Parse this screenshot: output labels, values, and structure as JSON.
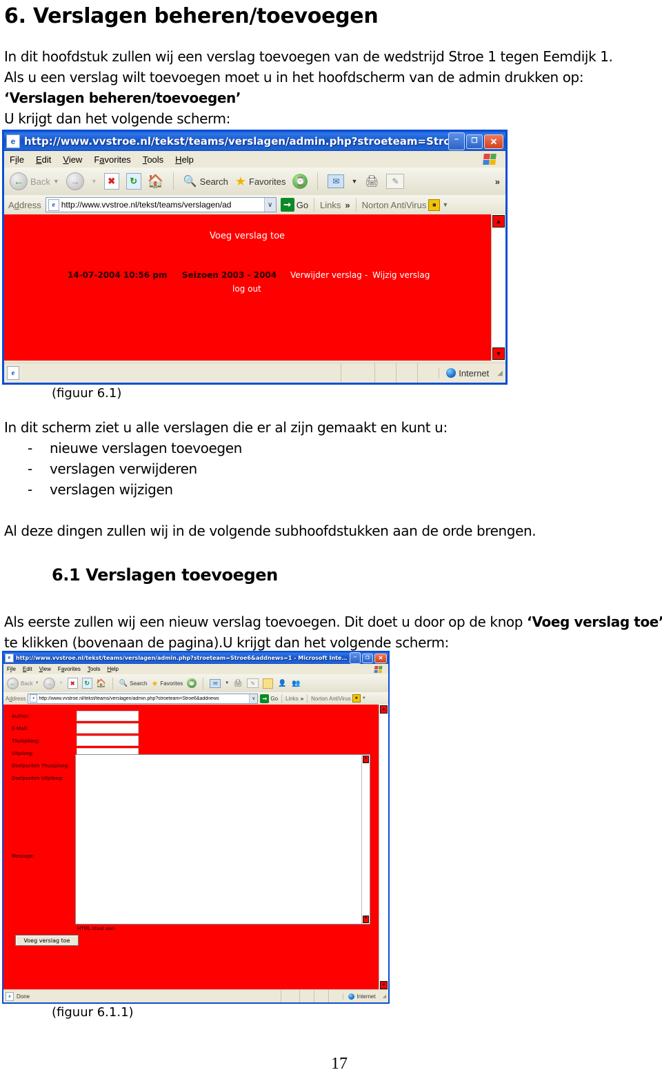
{
  "document": {
    "heading": "6. Verslagen beheren/toevoegen",
    "paragraphs": [
      "In dit hoofdstuk zullen wij een verslag toevoegen van de wedstrijd Stroe 1 tegen Eemdijk 1.",
      "Als u een verslag wilt toevoegen moet u in het hoofdscherm van de admin drukken op:",
      "‘Verslagen beheren/toevoegen’",
      "U krijgt dan het volgende scherm:"
    ],
    "figure1_caption": "(figuur 6.1)",
    "intro_line": "In dit scherm ziet u alle verslagen die er al zijn gemaakt en kunt u:",
    "bullets": [
      "nieuwe verslagen toevoegen",
      "verslagen verwijderen",
      "verslagen wijzigen"
    ],
    "bullet_marker": "-",
    "closing_line": "Al deze dingen zullen wij in de volgende subhoofdstukken aan de orde brengen.",
    "subheading": "6.1 Verslagen toevoegen",
    "body_line_1_pre": "Als eerste zullen wij een nieuw verslag toevoegen. Dit doet u door op de knop ",
    "body_line_1_bold": "‘Voeg verslag toe’",
    "body_line_2": "te klikken (bovenaan de pagina).U krijgt dan het volgende scherm:",
    "figure2_caption": "(figuur 6.1.1)",
    "page_number": "17"
  },
  "window1": {
    "title": "http://www.vvstroe.nl/tekst/teams/verslagen/admin.php?stroeteam=Stroe…",
    "title_icon": "ie-page-icon",
    "window_buttons": {
      "minimize": "–",
      "maximize": "❐",
      "close": "✕"
    },
    "menu": [
      {
        "pre": "F",
        "key": "i",
        "post": "le"
      },
      {
        "pre": "",
        "key": "E",
        "post": "dit"
      },
      {
        "pre": "",
        "key": "V",
        "post": "iew"
      },
      {
        "pre": "F",
        "key": "a",
        "post": "vorites"
      },
      {
        "pre": "",
        "key": "T",
        "post": "ools"
      },
      {
        "pre": "",
        "key": "H",
        "post": "elp"
      }
    ],
    "toolbar": {
      "back": "Back",
      "search": "Search",
      "favorites": "Favorites",
      "overflow": "»"
    },
    "address": {
      "label": "Address",
      "value": "http://www.vvstroe.nl/tekst/teams/verslagen/ad",
      "dropdown": "∨",
      "go": "Go",
      "links": "Links",
      "links_overflow": "»",
      "norton": "Norton AntiVirus"
    },
    "page": {
      "background_color": "#fe0000",
      "add_link": "Voeg verslag toe",
      "timestamp": "14-07-2004 10:56 pm",
      "season": "Seizoen 2003 - 2004",
      "delete_link": "Verwijder verslag",
      "link_separator": "-",
      "edit_link": "Wijzig verslag",
      "logout_link": "log out"
    },
    "status": {
      "zone": "Internet"
    },
    "scroll": {
      "up": "▲",
      "down": "▼"
    }
  },
  "window2": {
    "title": "http://www.vvstroe.nl/tekst/teams/verslagen/admin.php?stroeteam=Stroe6&addnews=1 - Microsoft Inte…",
    "window_buttons": {
      "minimize": "–",
      "maximize": "❐",
      "close": "✕"
    },
    "menu": [
      {
        "pre": "F",
        "key": "i",
        "post": "le"
      },
      {
        "pre": "",
        "key": "E",
        "post": "dit"
      },
      {
        "pre": "",
        "key": "V",
        "post": "iew"
      },
      {
        "pre": "F",
        "key": "a",
        "post": "vorites"
      },
      {
        "pre": "",
        "key": "T",
        "post": "ools"
      },
      {
        "pre": "",
        "key": "H",
        "post": "elp"
      }
    ],
    "toolbar": {
      "back": "Back",
      "search": "Search",
      "favorites": "Favorites"
    },
    "address": {
      "label": "Address",
      "value": "http://www.vvstroe.nl/tekst/teams/verslagen/admin.php?stroeteam=Stroe6&addnews",
      "dropdown": "∨",
      "go": "Go",
      "links": "Links",
      "links_overflow": "»",
      "norton": "Norton AntiVirus"
    },
    "form": {
      "background_color": "#fe0000",
      "fields": [
        {
          "label": "Author:",
          "value": ""
        },
        {
          "label": "E-Mail:",
          "value": ""
        },
        {
          "label": "Thuisploeg:",
          "value": ""
        },
        {
          "label": "Uitploeg:",
          "value": ""
        },
        {
          "label": "Doelpunten Thuisploeg:",
          "value": ""
        },
        {
          "label": "Doelpunten Uitploeg:",
          "value": ""
        }
      ],
      "message_label": "Message:",
      "message_value": "",
      "html_note": "HTML staat aan",
      "submit_label": "Voeg verslag toe"
    },
    "status": {
      "text": "Done",
      "zone": "Internet"
    },
    "scroll": {
      "up": "▲",
      "down": "▼"
    }
  }
}
